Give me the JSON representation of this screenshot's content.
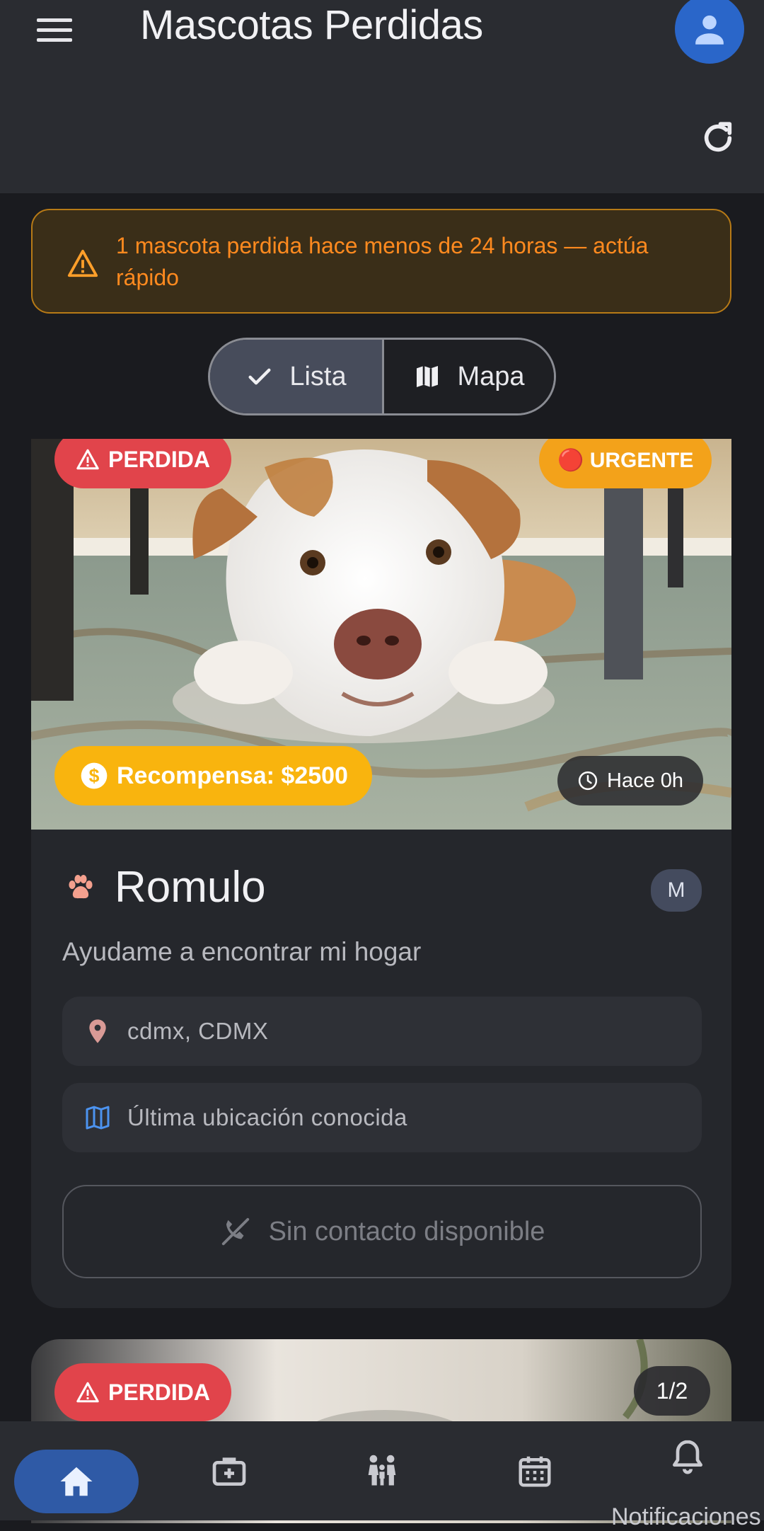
{
  "appbar": {
    "title": "Mascotas Perdidas"
  },
  "alert": {
    "text": "1 mascota perdida hace menos de 24 horas — actúa rápido",
    "color": "#ff8a1f"
  },
  "view_toggle": {
    "options": [
      {
        "label": "Lista",
        "selected": true
      },
      {
        "label": "Mapa",
        "selected": false
      }
    ]
  },
  "cards": [
    {
      "status": "PERDIDA",
      "urgency": "🔴 URGENTE",
      "reward": "Recompensa: $2500",
      "time": "Hace 0h",
      "name": "Romulo",
      "badge": "M",
      "description": "Ayudame a encontrar mi hogar",
      "location": "cdmx, CDMX",
      "map_link": "Última ubicación conocida",
      "contact": "Sin contacto disponible"
    },
    {
      "status": "PERDIDA",
      "image_counter": "1/2"
    }
  ],
  "bottom_nav": {
    "items": [
      {
        "icon": "home-icon",
        "active": true
      },
      {
        "icon": "medical-kit-icon",
        "active": false
      },
      {
        "icon": "family-icon",
        "active": false
      },
      {
        "icon": "calendar-icon",
        "active": false
      },
      {
        "icon": "bell-icon",
        "label": "Notificaciones",
        "active": false
      }
    ]
  },
  "colors": {
    "accent": "#2f5aa6",
    "lost": "#e1444b",
    "urgent": "#f3a21a",
    "reward": "#f9b40e"
  }
}
